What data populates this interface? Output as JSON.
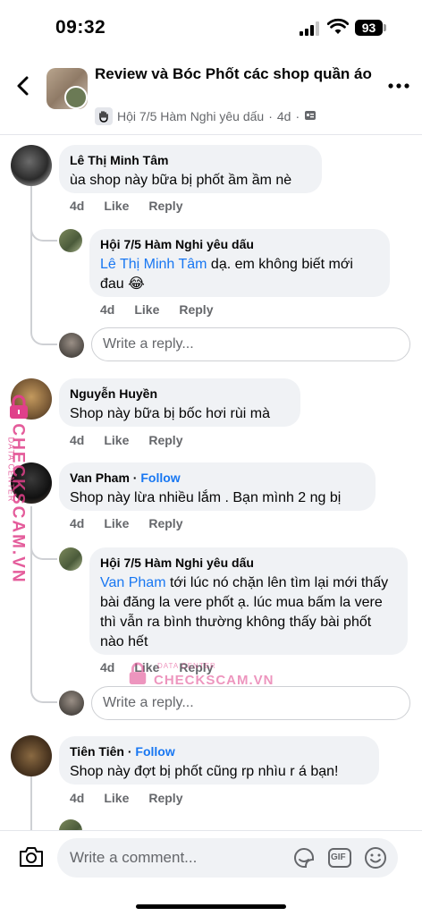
{
  "status_bar": {
    "time": "09:32",
    "battery": "93"
  },
  "header": {
    "title": "Review và Bóc Phốt các shop quần áo",
    "author": "Hội 7/5 Hàm Nghi yêu dấu",
    "age": "4d",
    "separator": "·"
  },
  "comments": [
    {
      "author": "Lê Thị Minh Tâm",
      "text": "ùa shop này bữa bị phốt ầm ầm nè",
      "age": "4d",
      "like": "Like",
      "reply": "Reply",
      "replies": [
        {
          "author": "Hội 7/5 Hàm Nghi yêu dấu",
          "mention": "Lê Thị Minh Tâm",
          "text": " dạ. em không biết mới đau 😂",
          "age": "4d",
          "like": "Like",
          "reply": "Reply"
        }
      ],
      "reply_placeholder": "Write a reply..."
    },
    {
      "author": "Nguyễn Huyền",
      "text": "Shop này bữa bị bốc hơi rùi mà",
      "age": "4d",
      "like": "Like",
      "reply": "Reply"
    },
    {
      "author": "Van Pham",
      "follow": "Follow",
      "text": "Shop này lừa nhiều lắm . Bạn mình 2 ng bị",
      "age": "4d",
      "like": "Like",
      "reply": "Reply",
      "replies": [
        {
          "author": "Hội 7/5 Hàm Nghi yêu dấu",
          "mention": "Van Pham",
          "text": " tới lúc nó chặn lên tìm lại mới thấy bài đăng la vere phốt ạ. lúc mua bấm la vere thì vẫn ra bình thường không thấy bài phốt nào hết",
          "age": "4d",
          "like": "Like",
          "reply": "Reply"
        }
      ],
      "reply_placeholder": "Write a reply..."
    },
    {
      "author": "Tiên Tiên",
      "follow": "Follow",
      "text": "Shop này đợt bị phốt cũng rp nhìu r á bạn!",
      "age": "4d",
      "like": "Like",
      "reply": "Reply"
    }
  ],
  "watermark": {
    "brand": "CHECKSCAM.VN",
    "tagline": "DATA CENTER"
  },
  "composer": {
    "placeholder": "Write a comment...",
    "gif": "GIF"
  },
  "colors": {
    "accent": "#1877f2",
    "bubble": "#f0f2f5",
    "muted": "#65676b",
    "watermark": "#e0408a"
  }
}
